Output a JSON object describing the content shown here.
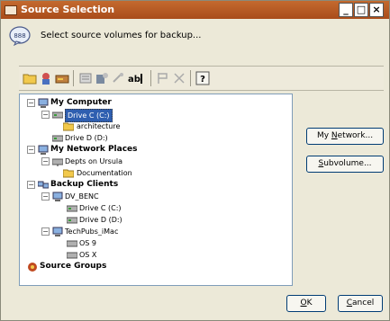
{
  "window": {
    "title": "Source Selection"
  },
  "header": {
    "instruction": "Select source volumes for backup..."
  },
  "toolbar": {
    "icons": [
      "new-folder-icon",
      "properties-icon",
      "drive-icon",
      "filter-icon",
      "permissions-icon",
      "refresh-icon",
      "rename-icon",
      "flag-icon",
      "delete-icon",
      "help-icon"
    ]
  },
  "tree": {
    "my_computer": "My Computer",
    "drive_c": "Drive C (C:)",
    "architecture": "architecture",
    "drive_d": "Drive D (D:)",
    "my_network_places": "My Network Places",
    "depts_on_ursula": "Depts on Ursula",
    "documentation": "Documentation",
    "backup_clients": "Backup Clients",
    "dv_benc": "DV_BENC",
    "dv_drive_c": "Drive C (C:)",
    "dv_drive_d": "Drive D (D:)",
    "techpubs_imac": "TechPubs_iMac",
    "os9": "OS 9",
    "osx": "OS X",
    "source_groups": "Source Groups"
  },
  "buttons": {
    "my_network_pre": "My ",
    "my_network_acc": "N",
    "my_network_post": "etwork...",
    "subvolume_acc": "S",
    "subvolume_post": "ubvolume...",
    "ok_acc": "O",
    "ok_post": "K",
    "cancel_acc": "C",
    "cancel_post": "ancel"
  },
  "colors": {
    "titlebar": "#b85a24",
    "selection": "#2f5fb0",
    "folder": "#f2c94c"
  }
}
